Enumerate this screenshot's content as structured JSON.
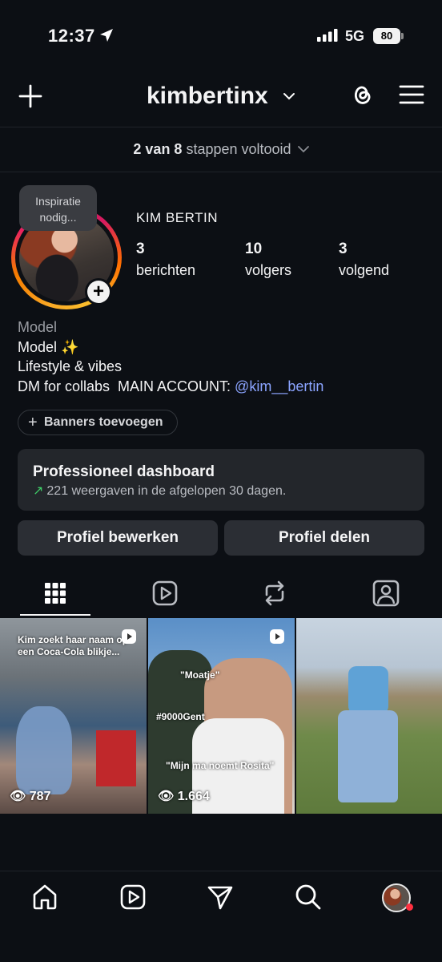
{
  "status_bar": {
    "time": "12:37",
    "network": "5G",
    "battery": "80"
  },
  "header": {
    "username": "kimbertinx"
  },
  "onboarding": {
    "count": "2 van 8",
    "text": "stappen voltooid"
  },
  "profile": {
    "note_bubble": "Inspiratie nodig...",
    "display_name": "KIM BERTIN",
    "stats": [
      {
        "value": "3",
        "label": "berichten"
      },
      {
        "value": "10",
        "label": "volgers"
      },
      {
        "value": "3",
        "label": "volgend"
      }
    ],
    "bio": {
      "category": "Model",
      "line1": "Model ✨",
      "line2": "Lifestyle & vibes",
      "line3_prefix": "DM for collabs  MAIN ACCOUNT: ",
      "mention": "@kim__bertin"
    }
  },
  "banner_button": "Banners toevoegen",
  "dashboard": {
    "title": "Professioneel dashboard",
    "subtitle": "221 weergaven in de afgelopen 30 dagen."
  },
  "buttons": {
    "edit": "Profiel bewerken",
    "share": "Profiel delen"
  },
  "tabs": [
    {
      "icon": "grid-icon",
      "active": true
    },
    {
      "icon": "reels-icon",
      "active": false
    },
    {
      "icon": "reposts-icon",
      "active": false
    },
    {
      "icon": "tagged-icon",
      "active": false
    }
  ],
  "posts": [
    {
      "caption": "Kim zoekt haar naam op een Coca-Cola blikje...",
      "views": "787",
      "type": "reel"
    },
    {
      "caption_top": "\"Moatje\"",
      "caption_mid": "#9000Gent",
      "caption_bottom": "\"Mijn ma noemt Rosita\"",
      "views": "1.664",
      "type": "reel"
    },
    {
      "type": "photo"
    }
  ],
  "bottom_nav": [
    "home-icon",
    "reels-icon",
    "send-icon",
    "search-icon",
    "profile-avatar"
  ],
  "colors": {
    "background": "#0c0f14",
    "mention": "#8ba4ff",
    "trend": "#3fcf68",
    "notification": "#ff3040"
  }
}
